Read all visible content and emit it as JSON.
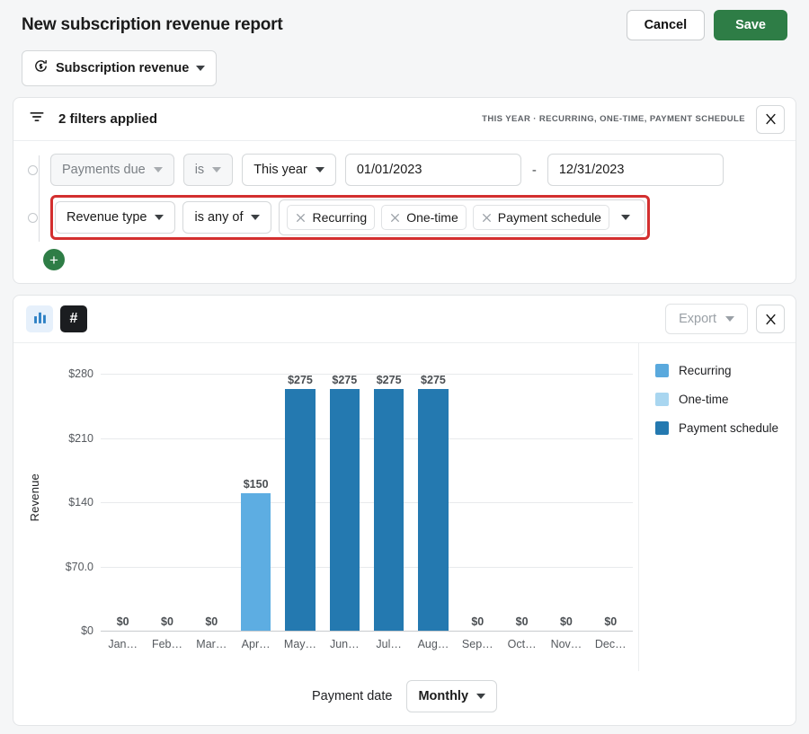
{
  "header": {
    "title": "New subscription revenue report",
    "cancel_label": "Cancel",
    "save_label": "Save",
    "report_selector": {
      "label": "Subscription revenue",
      "icon": "subscription-revenue-icon"
    }
  },
  "filters_card": {
    "icon": "filter-icon",
    "title": "2 filters applied",
    "summary": "THIS YEAR  ·  RECURRING, ONE-TIME, PAYMENT SCHEDULE",
    "close_icon": "collapse-icon",
    "rows": [
      {
        "field": "Payments due",
        "operator": "is",
        "value": "This year",
        "date_from": "01/01/2023",
        "date_to": "12/31/2023",
        "range_separator": "-"
      },
      {
        "field": "Revenue type",
        "operator": "is any of",
        "chips": [
          "Recurring",
          "One-time",
          "Payment schedule"
        ],
        "highlighted": true
      }
    ],
    "add_label": "+"
  },
  "chart_card": {
    "view_toggles": [
      {
        "name": "bar-chart-view",
        "icon": "bar-chart-icon",
        "active": true
      },
      {
        "name": "number-view",
        "icon": "hash-icon",
        "label": "#",
        "active": false
      }
    ],
    "export_label": "Export",
    "close_icon": "collapse-icon",
    "footer": {
      "label": "Payment date",
      "granularity": "Monthly"
    }
  },
  "chart_data": {
    "type": "bar",
    "title": "",
    "xlabel": "Payment date",
    "ylabel": "Revenue",
    "categories": [
      "Jan…",
      "Feb…",
      "Mar…",
      "Apr…",
      "May…",
      "Jun…",
      "Jul…",
      "Aug…",
      "Sep…",
      "Oct…",
      "Nov…",
      "Dec…"
    ],
    "values": [
      0,
      0,
      0,
      150,
      275,
      275,
      275,
      275,
      0,
      0,
      0,
      0
    ],
    "value_labels": [
      "$0",
      "$0",
      "$0",
      "$150",
      "$275",
      "$275",
      "$275",
      "$275",
      "$0",
      "$0",
      "$0",
      "$0"
    ],
    "bar_colors": [
      "#2e86c1",
      "#2e86c1",
      "#2e86c1",
      "#5dade2",
      "#2479b0",
      "#2479b0",
      "#2479b0",
      "#2479b0",
      "#2e86c1",
      "#2e86c1",
      "#2e86c1",
      "#2e86c1"
    ],
    "ylim": [
      0,
      280
    ],
    "yticks": [
      0,
      70,
      140,
      210,
      280
    ],
    "ytick_labels": [
      "$0",
      "$70.0",
      "$140",
      "$210",
      "$280"
    ],
    "grid": true,
    "legend_position": "right",
    "legend": [
      {
        "name": "Recurring",
        "color": "#5aa9dd"
      },
      {
        "name": "One-time",
        "color": "#a9d6f0"
      },
      {
        "name": "Payment schedule",
        "color": "#2479b0"
      }
    ]
  }
}
